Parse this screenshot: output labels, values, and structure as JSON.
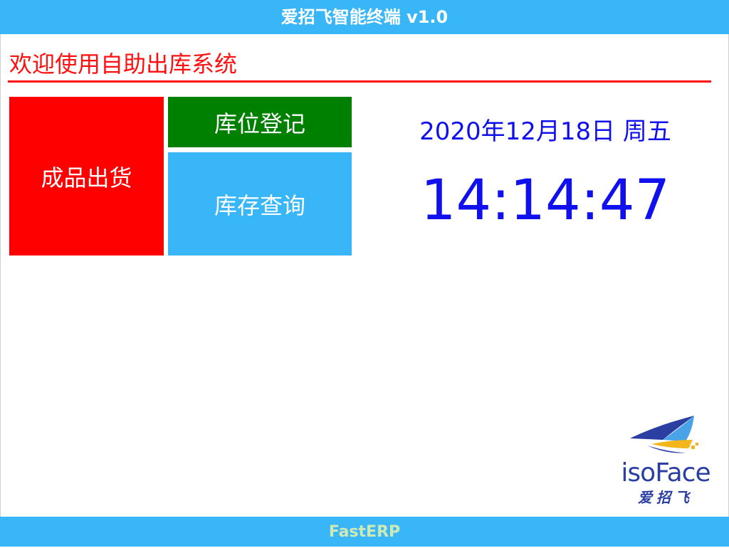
{
  "app": {
    "title": "爱招飞智能终端 v1.0"
  },
  "main": {
    "welcome": "欢迎使用自助出库系统",
    "tiles": [
      {
        "label": "成品出货",
        "color": "#ff0000"
      },
      {
        "label": "库位登记",
        "color": "#008000"
      },
      {
        "label": "库存查询",
        "color": "#38b6f8"
      }
    ],
    "clock": {
      "date": "2020年12月18日 周五",
      "time": "14:14:47",
      "color": "#1010ee"
    }
  },
  "logo": {
    "word_part1": "iso",
    "word_part2": "Face",
    "sub": "爱招飞",
    "icon": "airplane-wing-icon"
  },
  "footer": {
    "text": "FastERP"
  },
  "colors": {
    "accent": "#38b6f8",
    "welcome": "#ff1010"
  }
}
